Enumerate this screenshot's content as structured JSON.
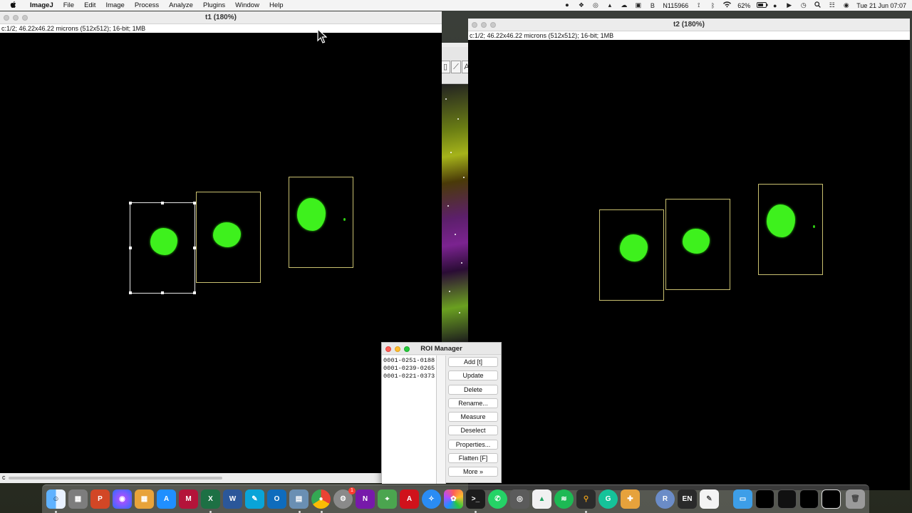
{
  "menubar": {
    "apple": "",
    "app_name": "ImageJ",
    "menus": [
      "File",
      "Edit",
      "Image",
      "Process",
      "Analyze",
      "Plugins",
      "Window",
      "Help"
    ],
    "status_user": "N115966",
    "battery": "62%",
    "datetime": "Tue 21 Jun  07:07"
  },
  "window_t1": {
    "title": "t1 (180%)",
    "info": "c:1/2; 46.22x46.22 microns (512x512); 16-bit; 1MB",
    "channel_label": "c"
  },
  "window_t2": {
    "title": "t2 (180%)",
    "info": "c:1/2; 46.22x46.22 microns (512x512); 16-bit; 1MB"
  },
  "roi_manager": {
    "title": "ROI Manager",
    "items": [
      "0001-0251-0188",
      "0001-0239-0265",
      "0001-0221-0373"
    ],
    "buttons": [
      "Add [t]",
      "Update",
      "Delete",
      "Rename...",
      "Measure",
      "Deselect",
      "Properties...",
      "Flatten [F]",
      "More »"
    ]
  },
  "colors": {
    "roi_outline": "#c9c070",
    "cell_green": "#3ef11d",
    "menubar_bg": "#f4f4f4"
  },
  "dock": {
    "items": [
      "finder-icon",
      "launchpad-icon",
      "powerpoint-icon",
      "siri-icon",
      "calculator-icon",
      "app-store-icon",
      "mendeley-icon",
      "excel-icon",
      "word-icon",
      "pen-icon",
      "outlook-icon",
      "preview-icon",
      "chrome-icon",
      "settings-icon",
      "onenote-icon",
      "maps-icon",
      "acrobat-icon",
      "safari-icon",
      "photos-icon",
      "terminal-icon",
      "whatsapp-icon",
      "screenshot-icon",
      "drive-icon",
      "spotify-icon",
      "microscope-icon",
      "grammarly-icon",
      "toolbox-icon",
      "r-icon",
      "en-icon",
      "notes-icon",
      "folder-icon",
      "window-thumb-icon",
      "window-thumb-icon",
      "window-thumb-icon",
      "window-thumb-icon",
      "trash-icon"
    ],
    "badge_settings": "1",
    "r_label": "R",
    "en_label": "EN"
  }
}
